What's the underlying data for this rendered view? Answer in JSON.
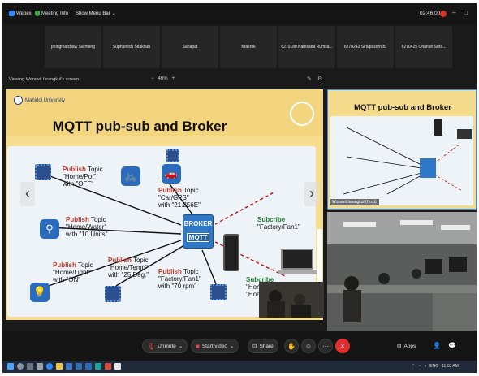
{
  "topbar": {
    "app_name": "Webex",
    "meeting_info": "Meeting Info",
    "show_menu_bar": "Show Menu Bar",
    "time": "02:46:00",
    "minimize": "–",
    "restore": "□",
    "close": "×"
  },
  "participants": [
    {
      "name": "phingmatchaw Sarmeng"
    },
    {
      "name": "Suphanitch Sdakhun"
    },
    {
      "name": "Sanapat"
    },
    {
      "name": "Krakrok"
    },
    {
      "name": "6270180 Kamsada Rumsa..."
    },
    {
      "name": "6270242 Siriupasorn B."
    },
    {
      "name": "6270425 Onanan Sora..."
    }
  ],
  "viewing": {
    "label": "Viewing Worawit Israngkul's screen",
    "zoom_out": "−",
    "zoom_level": "46%",
    "zoom_in": "+"
  },
  "slide": {
    "university": "Mahidol University",
    "title": "MQTT pub-sub and Broker",
    "publishers": [
      {
        "keyword": "Publish",
        "topic_word": "Topic",
        "topic": "\"Home/Pot\"",
        "value": "with \"OFF\""
      },
      {
        "keyword": "Publish",
        "topic_word": "Topic",
        "topic": "\"Home/Water\"",
        "value": "with \"10 Units\""
      },
      {
        "keyword": "Publish",
        "topic_word": "Topic",
        "topic": "\"Home/Light\"",
        "value": "with \"ON\""
      },
      {
        "keyword": "Publish",
        "topic_word": "Topic",
        "topic": "\"Car/GPS\"",
        "value": "with \"21.256E\""
      },
      {
        "keyword": "Publish",
        "topic_word": "Topic",
        "topic": "\"Home/Temp\"",
        "value": "with \"25 Deg.\""
      },
      {
        "keyword": "Publish",
        "topic_word": "Topic",
        "topic": "\"Factory/Fan1\"",
        "value": "with \"70 rpm\""
      }
    ],
    "broker_label": "BROKER",
    "mqtt_label": "MQTT",
    "subscribers": [
      {
        "keyword": "Subcribe",
        "topic": "\"Factory/Fan1\""
      },
      {
        "keyword": "Subcribe",
        "topic": "\"Hom",
        "topic2": "\"Hom"
      }
    ],
    "prev_arrow": "‹",
    "next_arrow": "›"
  },
  "right_panel": {
    "slide_title": "MQTT pub-sub and Broker",
    "presenter_name": "Worawit Israngkul (Host)"
  },
  "controls": {
    "unmute": "Unmute",
    "start_video": "Start video",
    "share": "Share",
    "apps": "Apps",
    "more": "···",
    "leave": "×"
  },
  "taskbar": {
    "lang": "ENG",
    "time": "11:03 AM"
  },
  "colors": {
    "slide_bg": "#f6dc8e",
    "publish_red": "#c0392b",
    "subscribe_green": "#1a7a2a",
    "broker_blue": "#2f78c8",
    "leave_red": "#e02f2f",
    "webex_blue": "#2d8cff"
  }
}
